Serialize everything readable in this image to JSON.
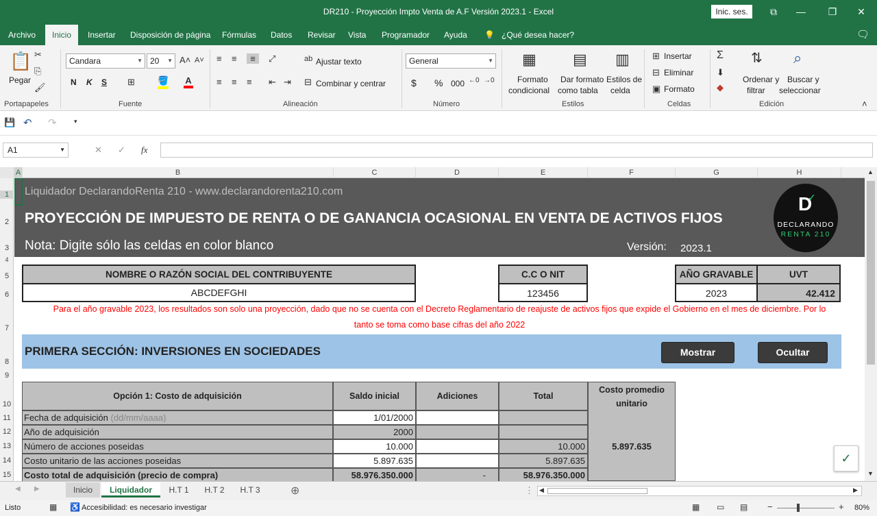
{
  "window": {
    "title": "DR210 - Proyección Impto Venta de A.F Versión 2023.1  -  Excel",
    "signin": "Inic. ses."
  },
  "menu": {
    "tabs": [
      "Archivo",
      "Inicio",
      "Insertar",
      "Disposición de página",
      "Fórmulas",
      "Datos",
      "Revisar",
      "Vista",
      "Programador",
      "Ayuda",
      "¿Qué desea hacer?"
    ],
    "active": "Inicio"
  },
  "ribbon": {
    "clipboard": {
      "paste": "Pegar",
      "label": "Portapapeles"
    },
    "font": {
      "name": "Candara",
      "size": "20",
      "bold": "N",
      "italic": "K",
      "underline": "S",
      "label": "Fuente"
    },
    "alignment": {
      "wrap": "Ajustar texto",
      "merge": "Combinar y centrar",
      "label": "Alineación"
    },
    "number": {
      "format": "General",
      "currency": "$",
      "percent": "%",
      "thousands": "000",
      "label": "Número"
    },
    "styles": {
      "conditional": [
        "Formato",
        "condicional"
      ],
      "table": [
        "Dar formato",
        "como tabla"
      ],
      "cell": [
        "Estilos de",
        "celda"
      ],
      "label": "Estilos"
    },
    "cells": {
      "insert": "Insertar",
      "delete": "Eliminar",
      "format": "Formato",
      "label": "Celdas"
    },
    "editing": {
      "sort": [
        "Ordenar y",
        "filtrar"
      ],
      "find": [
        "Buscar y",
        "seleccionar"
      ],
      "label": "Edición"
    }
  },
  "formula_bar": {
    "name_box": "A1",
    "value": ""
  },
  "columns": [
    "A",
    "B",
    "C",
    "D",
    "E",
    "F",
    "G",
    "H"
  ],
  "rows": [
    "1",
    "2",
    "3",
    "4",
    "5",
    "6",
    "7",
    "8",
    "9",
    "10",
    "11",
    "12",
    "13",
    "14",
    "15"
  ],
  "sheet": {
    "header_line1": "Liquidador DeclarandoRenta 210 - www.declarandorenta210.com",
    "header_title": "PROYECCIÓN DE IMPUESTO DE RENTA O DE GANANCIA OCASIONAL EN VENTA DE ACTIVOS FIJOS",
    "note": "Nota: Digite sólo las celdas en color blanco",
    "version_label": "Versión:",
    "version": "2023.1",
    "logo": {
      "line1": "DECLARANDO",
      "line2": "RENTA 210"
    },
    "taxpayer_label": "NOMBRE O RAZÓN SOCIAL DEL CONTRIBUYENTE",
    "taxpayer_value": "ABCDEFGHI",
    "nit_label": "C.C O NIT",
    "nit_value": "123456",
    "year_label": "AÑO GRAVABLE",
    "year_value": "2023",
    "uvt_label": "UVT",
    "uvt_value": "42.412",
    "warning": [
      "Para el año gravable 2023, los resultados son solo una proyección, dado que no se cuenta con el Decreto Reglamentario de reajuste de activos fijos que expide el Gobierno en el mes de diciembre. Por lo",
      "tanto se toma como base cifras del año 2022"
    ],
    "section_title": "PRIMERA SECCIÓN: INVERSIONES EN SOCIEDADES",
    "show_button": "Mostrar",
    "hide_button": "Ocultar",
    "table": {
      "headers": [
        "Opción 1: Costo de adquisición",
        "Saldo inicial",
        "Adiciones",
        "Total"
      ],
      "avg_header": [
        "Costo promedio",
        "unitario"
      ],
      "avg_value": "5.897.635",
      "rows": [
        {
          "label": "Fecha de adquisición",
          "hint": "(dd/mm/aaaa)",
          "saldo": "1/01/2000",
          "adiciones": "",
          "total": ""
        },
        {
          "label": "Año de adquisición",
          "hint": "",
          "saldo": "2000",
          "adiciones": "",
          "total": ""
        },
        {
          "label": "Número de acciones poseidas",
          "hint": "",
          "saldo": "10.000",
          "adiciones": "",
          "total": "10.000"
        },
        {
          "label": "Costo unitario de las acciones poseidas",
          "hint": "",
          "saldo": "5.897.635",
          "adiciones": "",
          "total": "5.897.635"
        },
        {
          "label": "Costo total de adquisición (precio de compra)",
          "hint": "",
          "saldo": "58.976.350.000",
          "adiciones": "-",
          "total": "58.976.350.000"
        }
      ]
    }
  },
  "sheet_tabs": [
    "Inicio",
    "Liquidador",
    "H.T 1",
    "H.T 2",
    "H.T 3"
  ],
  "active_sheet": "Liquidador",
  "status": {
    "ready": "Listo",
    "accessibility": "Accesibilidad: es necesario investigar",
    "zoom": "80%"
  },
  "colors": {
    "excel_green": "#217346",
    "banner": "#595959",
    "section_band": "#9dc3e6",
    "warning_red": "#ff0000",
    "gray_cell": "#bfbfbf"
  }
}
